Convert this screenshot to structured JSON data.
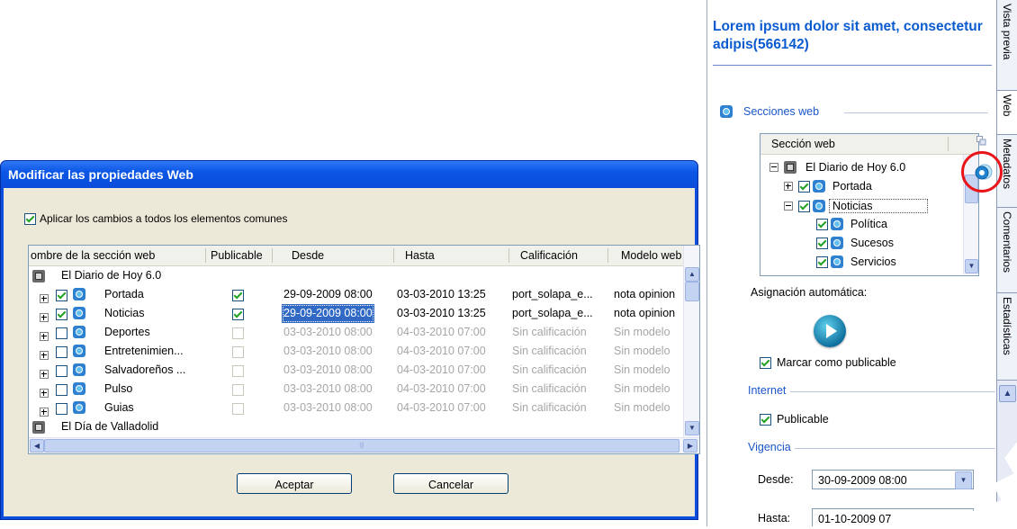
{
  "right_panel": {
    "title": "Lorem ipsum dolor sit amet, consectetur adipis(566142)",
    "vertical_tabs": [
      "Vista previa",
      "Web",
      "Metadatos",
      "Comentarios",
      "Estadísticas"
    ],
    "sections_label": "Secciones web",
    "tree_header": "Sección web",
    "tree": {
      "root": "El Diario de Hoy 6.0",
      "portada": "Portada",
      "noticias": "Noticias",
      "politica": "Política",
      "sucesos": "Sucesos",
      "servicios": "Servicios"
    },
    "auto_assign_label": "Asignación automática:",
    "mark_publishable_label": "Marcar como publicable",
    "internet_label": "Internet",
    "publishable_label": "Publicable",
    "vigencia_label": "Vigencia",
    "desde_label": "Desde:",
    "desde_value": "30-09-2009 08:00",
    "hasta_label": "Hasta:",
    "hasta_value": "01-10-2009 07"
  },
  "dialog": {
    "title": "Modificar las propiedades Web",
    "apply_all_label": "Aplicar los cambios a todos los elementos comunes",
    "columns": [
      "ombre de la sección web",
      "Publicable",
      "Desde",
      "Hasta",
      "Calificación",
      "Modelo web"
    ],
    "root1": "El Diario de Hoy 6.0",
    "rows": [
      {
        "name": "Portada",
        "checked": true,
        "publicable": true,
        "desde": "29-09-2009 08:00",
        "hasta": "03-03-2010 13:25",
        "calificacion": "port_solapa_e...",
        "modelo": "nota opinion",
        "enabled": true
      },
      {
        "name": "Noticias",
        "checked": true,
        "publicable": true,
        "desde": "29-09-2009 08:00",
        "hasta": "03-03-2010 13:25",
        "calificacion": "port_solapa_e...",
        "modelo": "nota opinion",
        "enabled": true
      },
      {
        "name": "Deportes",
        "checked": false,
        "publicable": false,
        "desde": "03-03-2010 08:00",
        "hasta": "04-03-2010 07:00",
        "calificacion": "Sin calificación",
        "modelo": "Sin modelo",
        "enabled": false
      },
      {
        "name": "Entretenimien...",
        "checked": false,
        "publicable": false,
        "desde": "03-03-2010 08:00",
        "hasta": "04-03-2010 07:00",
        "calificacion": "Sin calificación",
        "modelo": "Sin modelo",
        "enabled": false
      },
      {
        "name": "Salvadoreños ...",
        "checked": false,
        "publicable": false,
        "desde": "03-03-2010 08:00",
        "hasta": "04-03-2010 07:00",
        "calificacion": "Sin calificación",
        "modelo": "Sin modelo",
        "enabled": false
      },
      {
        "name": "Pulso",
        "checked": false,
        "publicable": false,
        "desde": "03-03-2010 08:00",
        "hasta": "04-03-2010 07:00",
        "calificacion": "Sin calificación",
        "modelo": "Sin modelo",
        "enabled": false
      },
      {
        "name": "Guias",
        "checked": false,
        "publicable": false,
        "desde": "03-03-2010 08:00",
        "hasta": "04-03-2010 07:00",
        "calificacion": "Sin calificación",
        "modelo": "Sin modelo",
        "enabled": false
      }
    ],
    "root2": "El Día de Valladolid",
    "accept_label": "Aceptar",
    "cancel_label": "Cancelar"
  },
  "colors": {
    "title_bar": "#0a4ee0",
    "dialog_body": "#ece9d8",
    "panel_title": "#0b5bd0",
    "highlight_circle": "#e8161a",
    "selection": "#316ac5"
  }
}
